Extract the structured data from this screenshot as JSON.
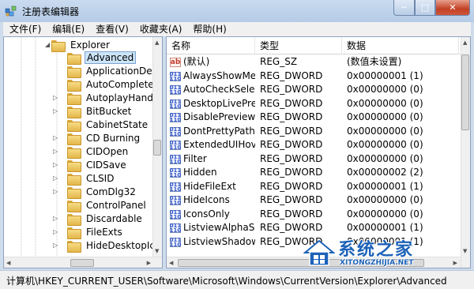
{
  "window": {
    "title": "注册表编辑器",
    "min_glyph": "─",
    "max_glyph": "□",
    "close_glyph": "✕"
  },
  "menu": [
    "文件(F)",
    "编辑(E)",
    "查看(V)",
    "收藏夹(A)",
    "帮助(H)"
  ],
  "tree": {
    "root": "Explorer",
    "items": [
      {
        "label": "Advanced",
        "selected": true,
        "expandable": false
      },
      {
        "label": "ApplicationDesti",
        "expandable": false
      },
      {
        "label": "AutoComplete",
        "expandable": false
      },
      {
        "label": "AutoplayHandler",
        "expandable": true
      },
      {
        "label": "BitBucket",
        "expandable": true
      },
      {
        "label": "CabinetState",
        "expandable": false
      },
      {
        "label": "CD Burning",
        "expandable": true
      },
      {
        "label": "CIDOpen",
        "expandable": true
      },
      {
        "label": "CIDSave",
        "expandable": true
      },
      {
        "label": "CLSID",
        "expandable": true
      },
      {
        "label": "ComDlg32",
        "expandable": true
      },
      {
        "label": "ControlPanel",
        "expandable": false
      },
      {
        "label": "Discardable",
        "expandable": true
      },
      {
        "label": "FileExts",
        "expandable": true
      },
      {
        "label": "HideDesktopIcor",
        "expandable": true
      }
    ]
  },
  "list": {
    "columns": {
      "name": "名称",
      "type": "类型",
      "data": "数据"
    },
    "rows": [
      {
        "icon": "string",
        "name": "(默认)",
        "type": "REG_SZ",
        "data": "(数值未设置)"
      },
      {
        "icon": "binary",
        "name": "AlwaysShowMe...",
        "type": "REG_DWORD",
        "data": "0x00000001 (1)"
      },
      {
        "icon": "binary",
        "name": "AutoCheckSelect",
        "type": "REG_DWORD",
        "data": "0x00000000 (0)"
      },
      {
        "icon": "binary",
        "name": "DesktopLivePrev...",
        "type": "REG_DWORD",
        "data": "0x00000000 (0)"
      },
      {
        "icon": "binary",
        "name": "DisablePreviewD...",
        "type": "REG_DWORD",
        "data": "0x00000000 (0)"
      },
      {
        "icon": "binary",
        "name": "DontPrettyPath",
        "type": "REG_DWORD",
        "data": "0x00000000 (0)"
      },
      {
        "icon": "binary",
        "name": "ExtendedUIHove...",
        "type": "REG_DWORD",
        "data": "0x00000000 (0)"
      },
      {
        "icon": "binary",
        "name": "Filter",
        "type": "REG_DWORD",
        "data": "0x00000000 (0)"
      },
      {
        "icon": "binary",
        "name": "Hidden",
        "type": "REG_DWORD",
        "data": "0x00000002 (2)"
      },
      {
        "icon": "binary",
        "name": "HideFileExt",
        "type": "REG_DWORD",
        "data": "0x00000001 (1)"
      },
      {
        "icon": "binary",
        "name": "HideIcons",
        "type": "REG_DWORD",
        "data": "0x00000000 (0)"
      },
      {
        "icon": "binary",
        "name": "IconsOnly",
        "type": "REG_DWORD",
        "data": "0x00000000 (0)"
      },
      {
        "icon": "binary",
        "name": "ListviewAlphaSe...",
        "type": "REG_DWORD",
        "data": "0x00000001 (1)"
      },
      {
        "icon": "binary",
        "name": "ListviewShadow",
        "type": "REG_DWORD",
        "data": "0x00000001 (1)"
      }
    ]
  },
  "icons": {
    "string_value": "ab",
    "binary_value": "011\n110"
  },
  "status": {
    "path": "计算机\\HKEY_CURRENT_USER\\Software\\Microsoft\\Windows\\CurrentVersion\\Explorer\\Advanced"
  },
  "watermark": {
    "brand": "系统之家",
    "domain": "XITONGZHIJIA.NET"
  },
  "colors": {
    "frame": "#cfdcec",
    "selection": "#cce4f7",
    "watermark": "#1d62b8",
    "close": "#c24124"
  }
}
